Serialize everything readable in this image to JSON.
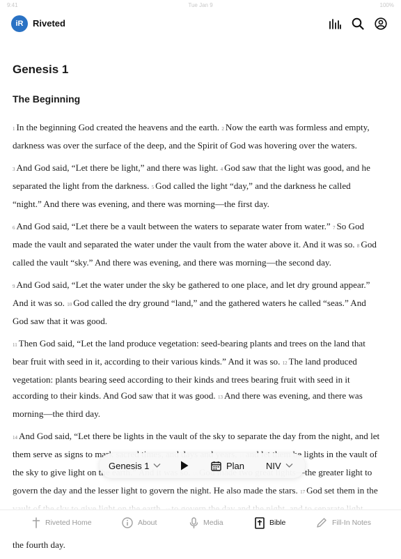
{
  "status_bar": {
    "time": "9:41",
    "date": "Tue Jan 9",
    "battery": "100%"
  },
  "header": {
    "logo_text": "iR",
    "app_name": "Riveted",
    "icons": [
      "audio-bars-icon",
      "search-icon",
      "account-icon"
    ]
  },
  "content": {
    "chapter_title": "Genesis 1",
    "section_title": "The Beginning",
    "paragraphs": [
      [
        {
          "n": "1",
          "t": "In the beginning God created the heavens and the earth. "
        },
        {
          "n": "2",
          "t": "Now the earth was formless and empty, darkness was over the surface of the deep, and the Spirit of God was hovering over the waters."
        }
      ],
      [
        {
          "n": "3",
          "t": "And God said, “Let there be light,” and there was light. "
        },
        {
          "n": "4",
          "t": "God saw that the light was good, and he separated the light from the darkness. "
        },
        {
          "n": "5",
          "t": "God called the light “day,” and the darkness he called “night.” And there was evening, and there was morning—the first day."
        }
      ],
      [
        {
          "n": "6",
          "t": "And God said, “Let there be a vault between the waters to separate water from water.” "
        },
        {
          "n": "7",
          "t": "So God made the vault and separated the water under the vault from the water above it. And it was so. "
        },
        {
          "n": "8",
          "t": "God called the vault “sky.” And there was evening, and there was morning—the second day."
        }
      ],
      [
        {
          "n": "9",
          "t": "And God said, “Let the water under the sky be gathered to one place, and let dry ground appear.” And it was so. "
        },
        {
          "n": "10",
          "t": "God called the dry ground “land,” and the gathered waters he called “seas.” And God saw that it was good."
        }
      ],
      [
        {
          "n": "11",
          "t": "Then God said, “Let the land produce vegetation: seed-bearing plants and trees on the land that bear fruit with seed in it, according to their various kinds.” And it was so. "
        },
        {
          "n": "12",
          "t": "The land produced vegetation: plants bearing seed according to their kinds and trees bearing fruit with seed in it according to their kinds. And God saw that it was good. "
        },
        {
          "n": "13",
          "t": "And there was evening, and there was morning—the third day."
        }
      ],
      [
        {
          "n": "14",
          "t": "And God said, “Let there be lights in the vault of the sky to separate the day from the night, and let them serve as signs to mark sacred times, and days and years, "
        },
        {
          "n": "15",
          "t": "and let them be lights in the vault of the sky to give light on the earth.” And it was so. "
        },
        {
          "n": "16",
          "t": "God made two great lights—the greater light to govern the day and the lesser light to govern the night. He also made the stars. "
        },
        {
          "n": "17",
          "t": "God set them in the vault of the sky to give light on the earth, "
        },
        {
          "n": "18",
          "t": "to govern the day and the night, and to separate light from darkness. And God saw that it was good. "
        },
        {
          "n": "19",
          "t": "And there was evening, and there was morning—the fourth day."
        }
      ]
    ]
  },
  "player_bar": {
    "chapter_label": "Genesis 1",
    "plan_label": "Plan",
    "version_label": "NIV"
  },
  "tabbar": {
    "items": [
      {
        "label": "Riveted Home",
        "icon": "cross-icon",
        "active": false
      },
      {
        "label": "About",
        "icon": "info-icon",
        "active": false
      },
      {
        "label": "Media",
        "icon": "microphone-icon",
        "active": false
      },
      {
        "label": "Bible",
        "icon": "bible-icon",
        "active": true
      },
      {
        "label": "Fill-In Notes",
        "icon": "pencil-icon",
        "active": false
      }
    ]
  },
  "colors": {
    "accent": "#2a72c4",
    "text": "#1a1a1a",
    "muted": "#9a9a9a"
  }
}
